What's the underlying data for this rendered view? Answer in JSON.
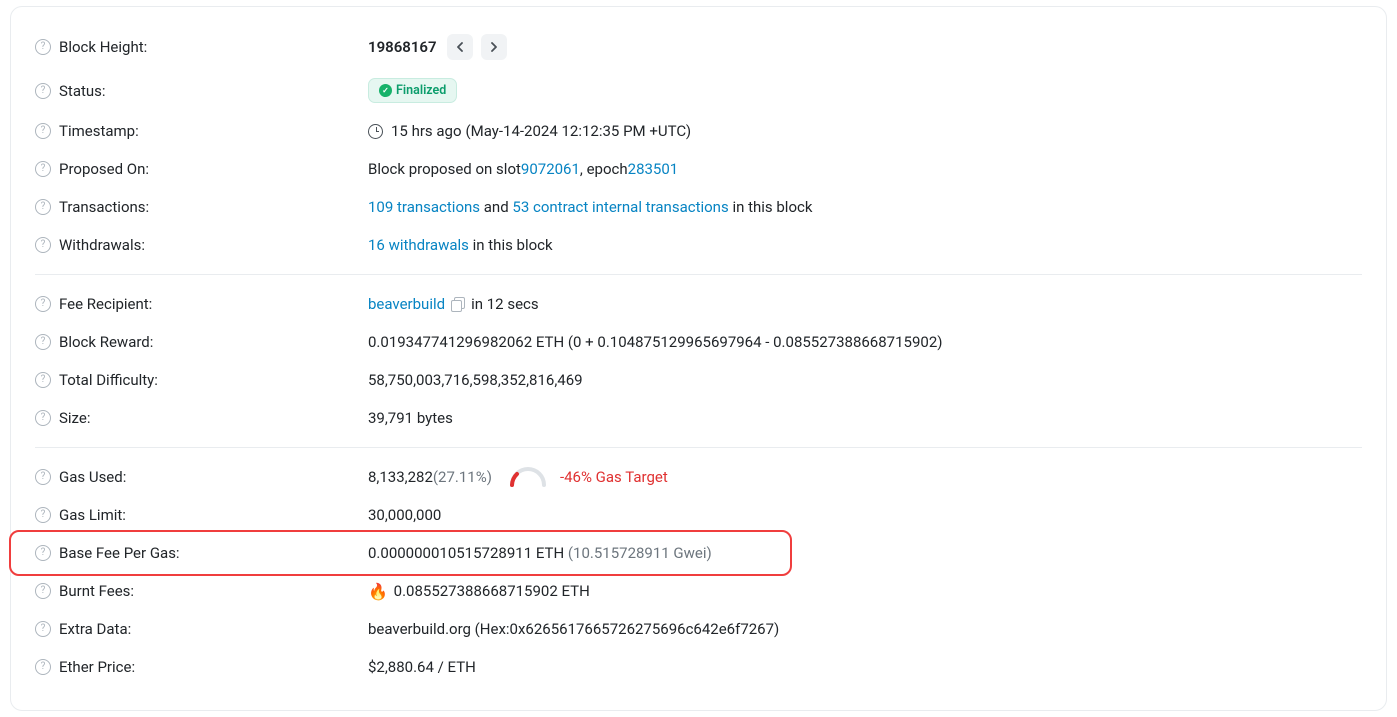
{
  "labels": {
    "block_height": "Block Height:",
    "status": "Status:",
    "timestamp": "Timestamp:",
    "proposed_on": "Proposed On:",
    "transactions": "Transactions:",
    "withdrawals": "Withdrawals:",
    "fee_recipient": "Fee Recipient:",
    "block_reward": "Block Reward:",
    "total_difficulty": "Total Difficulty:",
    "size": "Size:",
    "gas_used": "Gas Used:",
    "gas_limit": "Gas Limit:",
    "base_fee": "Base Fee Per Gas:",
    "burnt_fees": "Burnt Fees:",
    "extra_data": "Extra Data:",
    "ether_price": "Ether Price:"
  },
  "block_height": "19868167",
  "status_badge": "Finalized",
  "timestamp": {
    "relative": "15 hrs ago",
    "absolute": "(May-14-2024 12:12:35 PM +UTC)"
  },
  "proposed": {
    "prefix": "Block proposed on slot ",
    "slot": "9072061",
    "mid": ", epoch ",
    "epoch": "283501"
  },
  "transactions": {
    "tx_link": "109 transactions",
    "and": " and ",
    "internal_link": "53 contract internal transactions",
    "suffix": " in this block"
  },
  "withdrawals": {
    "link": "16 withdrawals",
    "suffix": " in this block"
  },
  "fee_recipient": {
    "name": "beaverbuild",
    "suffix": " in 12 secs"
  },
  "block_reward": "0.019347741296982062 ETH (0 + 0.104875129965697964 - 0.085527388668715902)",
  "total_difficulty": "58,750,003,716,598,352,816,469",
  "size": "39,791 bytes",
  "gas_used": {
    "value": "8,133,282",
    "pct": "(27.11%)",
    "target": "-46% Gas Target"
  },
  "gas_limit": "30,000,000",
  "base_fee": {
    "eth": "0.000000010515728911 ETH",
    "gwei": " (10.515728911 Gwei)"
  },
  "burnt_fees": " 0.085527388668715902 ETH",
  "extra_data": "beaverbuild.org (Hex:0x6265617665726275696c642e6f7267)",
  "ether_price": "$2,880.64 / ETH"
}
